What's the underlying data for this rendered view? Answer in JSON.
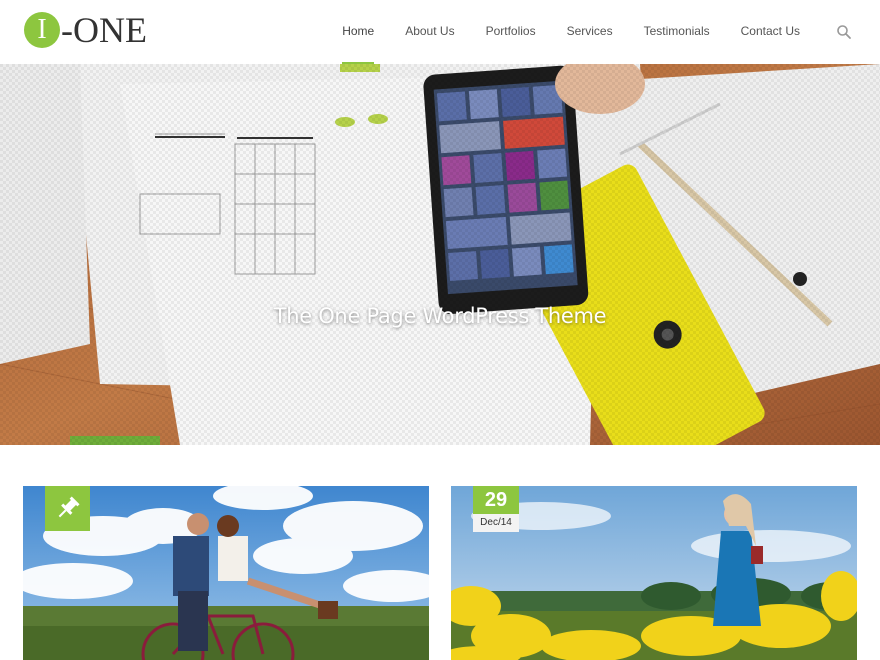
{
  "logo": {
    "mark": "I",
    "text": "-ONE"
  },
  "nav": {
    "items": [
      {
        "label": "Home",
        "active": true
      },
      {
        "label": "About Us"
      },
      {
        "label": "Portfolios"
      },
      {
        "label": "Services"
      },
      {
        "label": "Testimonials"
      },
      {
        "label": "Contact Us"
      }
    ],
    "search_icon": "search-icon"
  },
  "hero": {
    "title": "The One Page WordPress Theme"
  },
  "posts": [
    {
      "badge_icon": "pin-icon",
      "image": "couple-on-bicycle-photo"
    },
    {
      "date_day": "29",
      "date_month": "Dec/14",
      "image": "woman-in-flower-field-photo"
    }
  ],
  "colors": {
    "accent": "#8dc63f",
    "text": "#555555"
  }
}
